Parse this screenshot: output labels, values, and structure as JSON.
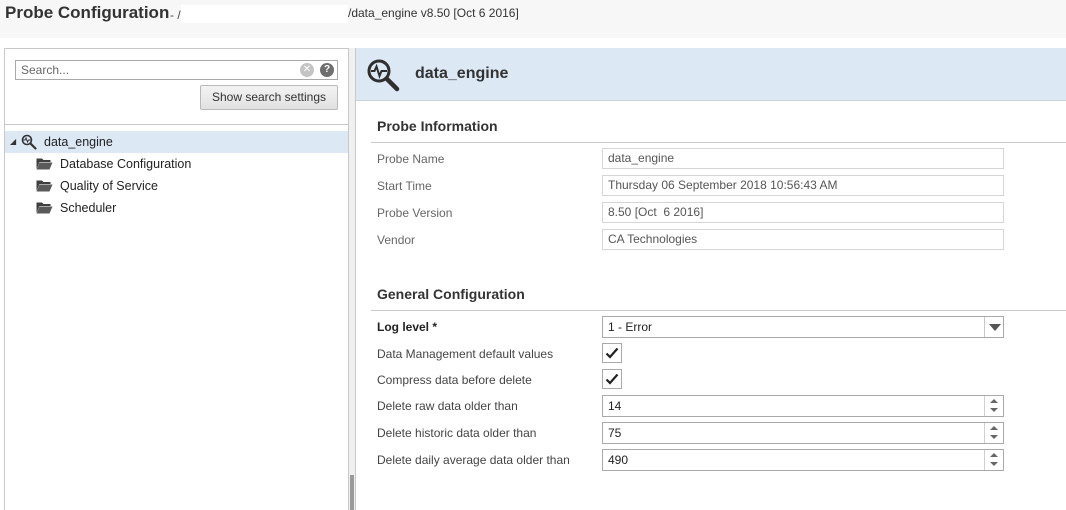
{
  "window": {
    "title": "Probe Configuration",
    "separator": "- /",
    "path": "/data_engine v8.50 [Oct 6 2016]"
  },
  "search": {
    "placeholder": "Search...",
    "settings_button": "Show search settings"
  },
  "tree": {
    "root": {
      "label": "data_engine",
      "icon": "probe-search-icon",
      "expanded": true
    },
    "children": [
      {
        "label": "Database Configuration",
        "icon": "folder-icon"
      },
      {
        "label": "Quality of Service",
        "icon": "folder-icon"
      },
      {
        "label": "Scheduler",
        "icon": "folder-icon"
      }
    ]
  },
  "header": {
    "title": "data_engine",
    "icon": "probe-search-icon"
  },
  "probe_info": {
    "section_title": "Probe Information",
    "fields": [
      {
        "label": "Probe Name",
        "value": "data_engine"
      },
      {
        "label": "Start Time",
        "value": "Thursday 06 September 2018 10:56:43 AM"
      },
      {
        "label": "Probe Version",
        "value": "8.50 [Oct  6 2016]"
      },
      {
        "label": "Vendor",
        "value": "CA Technologies"
      }
    ]
  },
  "general_config": {
    "section_title": "General Configuration",
    "log_level": {
      "label": "Log level *",
      "value": "1 - Error"
    },
    "data_mgmt_defaults": {
      "label": "Data Management default values",
      "checked": true
    },
    "compress_before_delete": {
      "label": "Compress data before delete",
      "checked": true
    },
    "delete_raw": {
      "label": "Delete raw data older than",
      "value": "14"
    },
    "delete_historic": {
      "label": "Delete historic data older than",
      "value": "75"
    },
    "delete_daily_avg": {
      "label": "Delete daily average data older than",
      "value": "490"
    }
  },
  "colors": {
    "header_bg": "#dde8f5",
    "selected_row_bg": "#dde8f5"
  }
}
